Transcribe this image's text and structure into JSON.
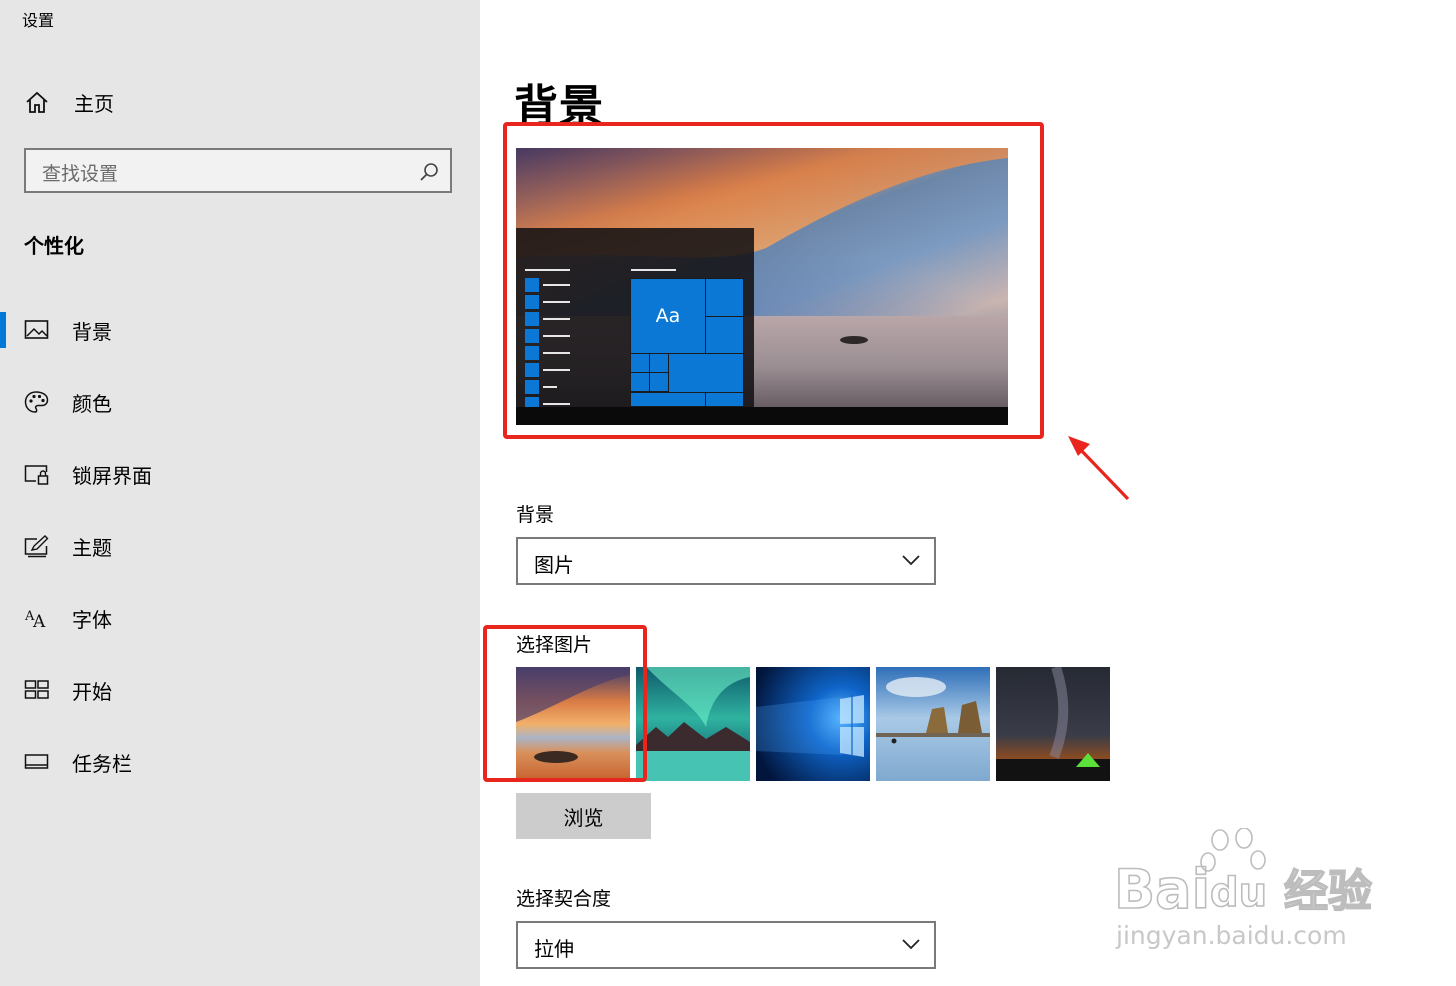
{
  "window": {
    "title": "设置"
  },
  "sidebar": {
    "home_label": "主页",
    "search_placeholder": "查找设置",
    "section_title": "个性化",
    "items": [
      {
        "label": "背景",
        "icon": "picture-icon",
        "active": true
      },
      {
        "label": "颜色",
        "icon": "palette-icon",
        "active": false
      },
      {
        "label": "锁屏界面",
        "icon": "lock-screen-icon",
        "active": false
      },
      {
        "label": "主题",
        "icon": "theme-brush-icon",
        "active": false
      },
      {
        "label": "字体",
        "icon": "font-icon",
        "active": false
      },
      {
        "label": "开始",
        "icon": "start-tiles-icon",
        "active": false
      },
      {
        "label": "任务栏",
        "icon": "taskbar-icon",
        "active": false
      }
    ]
  },
  "main": {
    "page_title": "背景",
    "preview": {
      "tile_label": "Aa"
    },
    "background_label": "背景",
    "background_value": "图片",
    "choose_picture_label": "选择图片",
    "thumbnails": [
      "sunset-sea",
      "aurora-lake",
      "windows-10-light",
      "beach-rocks",
      "milky-way-tent"
    ],
    "browse_label": "浏览",
    "fit_label": "选择契合度",
    "fit_value": "拉伸"
  },
  "annotations": {
    "color": "#e8261d"
  },
  "accent_color": "#0078d7",
  "watermark": {
    "brand": "Bai",
    "brand2": "du",
    "brand_cn": "经验",
    "url": "jingyan.baidu.com"
  }
}
